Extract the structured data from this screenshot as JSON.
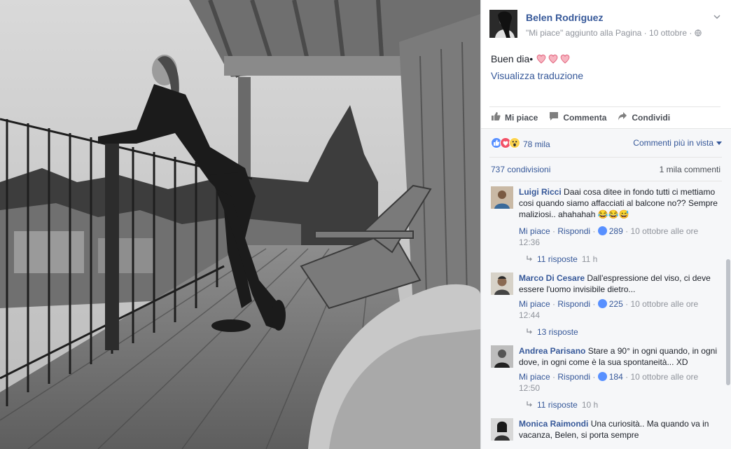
{
  "post": {
    "page_name": "Belen Rodriguez",
    "subline": "\"Mi piace\" aggiunto alla Pagina · 10 ottobre · ",
    "text": "Buen dia•",
    "translate_label": "Visualizza traduzione"
  },
  "actions": {
    "like": "Mi piace",
    "comment": "Commenta",
    "share": "Condividi"
  },
  "feedback": {
    "reactions_count": "78 mila",
    "sort_label": "Commenti più in vista",
    "shares": "737 condivisioni",
    "comments_total": "1 mila commenti"
  },
  "comments": [
    {
      "author": "Luigi Ricci",
      "text": "Daai cosa ditee in fondo tutti ci mettiamo cosi quando siamo affacciati al balcone no?? Sempre maliziosi.. ahahahah 😂😂😅",
      "like": "Mi piace",
      "reply": "Rispondi",
      "likes": "289",
      "date": "10 ottobre alle ore",
      "time": "12:36",
      "replies": "11 risposte",
      "replies_time": "11 h"
    },
    {
      "author": "Marco Di Cesare",
      "text": "Dall'espressione del viso, ci deve essere l'uomo invisibile dietro...",
      "like": "Mi piace",
      "reply": "Rispondi",
      "likes": "225",
      "date": "10 ottobre alle ore",
      "time": "12:44",
      "replies": "13 risposte",
      "replies_time": ""
    },
    {
      "author": "Andrea Parisano",
      "text": "Stare a 90° in ogni quando, in ogni dove, in ogni come è la sua spontaneità... XD",
      "like": "Mi piace",
      "reply": "Rispondi",
      "likes": "184",
      "date": "10 ottobre alle ore",
      "time": "12:50",
      "replies": "11 risposte",
      "replies_time": "10 h"
    },
    {
      "author": "Monica Raimondi",
      "text": "Una curiosità.. Ma quando va in vacanza, Belen, si porta sempre",
      "like": "",
      "reply": "",
      "likes": "",
      "date": "",
      "time": "",
      "replies": "",
      "replies_time": ""
    }
  ],
  "colors": {
    "link": "#365899",
    "meta": "#90949c",
    "feedback_bg": "#f6f7f9",
    "like_blue": "#5890ff",
    "love_red": "#f25268"
  },
  "icons": [
    "globe-icon",
    "chevron-down-icon",
    "thumbs-up-icon",
    "comment-icon",
    "share-icon",
    "like-reaction-icon",
    "love-reaction-icon",
    "wow-reaction-icon",
    "heart-emoji-icon",
    "reply-arrow-icon"
  ]
}
